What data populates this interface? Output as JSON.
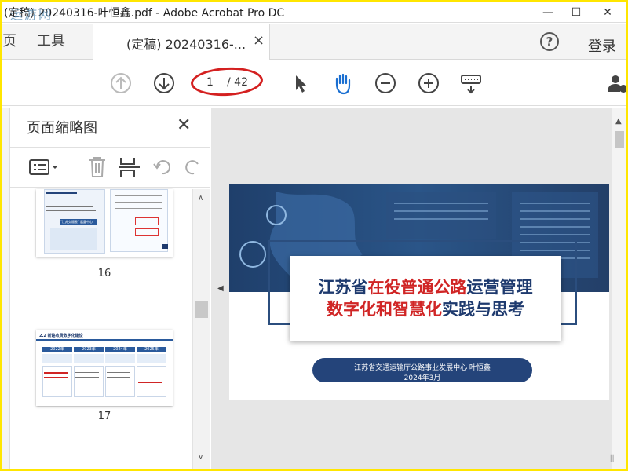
{
  "window": {
    "title": "(定稿) 20240316-叶恒鑫.pdf - Adobe Acrobat Pro DC",
    "watermark": "运游网",
    "minimize": "—",
    "maximize": "☐",
    "close": "✕"
  },
  "tabs": {
    "home_partial": "页",
    "tools": "工具",
    "doc_tab": "(定稿) 20240316-...",
    "doc_close": "×",
    "help": "?",
    "login": "登录"
  },
  "toolbar": {
    "page_current": "1",
    "page_total": "/ 42",
    "icons": [
      "prev-page-icon",
      "next-page-icon",
      "select-cursor-icon",
      "hand-tool-icon",
      "zoom-out-icon",
      "zoom-in-icon",
      "keyboard-icon",
      "share-user-icon"
    ]
  },
  "panel": {
    "title": "页面缩略图",
    "close": "✕",
    "thumbnails": [
      {
        "label": "16"
      },
      {
        "label": "17"
      }
    ],
    "thumb17": {
      "heading": "2.2  新路收费数字化建设",
      "years": [
        "2022年",
        "2023年",
        "2024年",
        "2025年"
      ]
    },
    "thumb16": {
      "caption": "\"江苏交通云\" 展露中心"
    }
  },
  "document": {
    "title_line1_a": "江苏省",
    "title_line1_b": "在役普通公路",
    "title_line1_c": "运营管理",
    "title_line2_a": "数字化和智慧化",
    "title_line2_b": "实践与思考",
    "org": "江苏省交通运输厅公路事业发展中心 叶恒鑫",
    "date": "2024年3月"
  },
  "colors": {
    "frame": "#ffe600",
    "navy": "#1e3a6e",
    "red": "#d02525",
    "annotation": "#d42020"
  }
}
